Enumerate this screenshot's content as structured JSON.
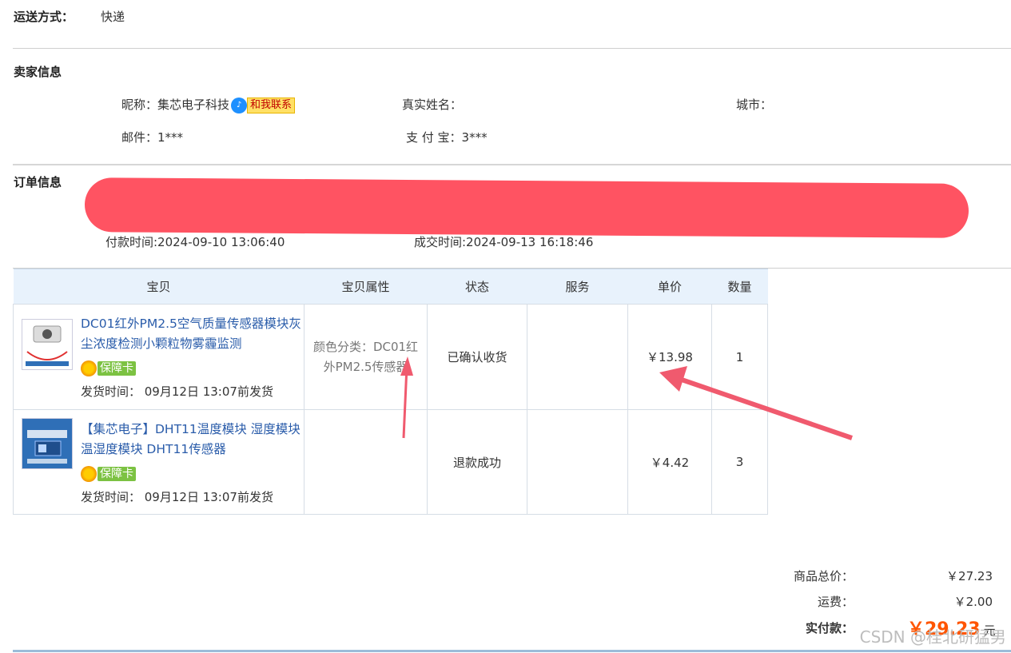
{
  "shipping": {
    "label": "运送方式：",
    "value": "快递"
  },
  "seller": {
    "section_title": "卖家信息",
    "nickname_label": "昵称：",
    "nickname": "集芯电子科技",
    "contact_label": "和我联系",
    "realname_label": "真实姓名：",
    "city_label": "城市：",
    "email_label": "邮件：",
    "email": "1***",
    "alipay_label": "支 付 宝：",
    "alipay": "3***"
  },
  "order": {
    "section_title": "订单信息",
    "paid_time": "付款时间:2024-09-10 13:06:40",
    "deal_time": "成交时间:2024-09-13 16:18:46"
  },
  "table": {
    "headers": [
      "宝贝",
      "宝贝属性",
      "状态",
      "服务",
      "单价",
      "数量"
    ],
    "rows": [
      {
        "title": "DC01红外PM2.5空气质量传感器模块灰尘浓度检测小颗粒物雾霾监测",
        "warranty": "保障卡",
        "ship": "发货时间：  09月12日 13:07前发货",
        "attr": "颜色分类：DC01红外PM2.5传感器",
        "status": "已确认收货",
        "service": "",
        "price": "￥13.98",
        "qty": "1"
      },
      {
        "title": "【集芯电子】DHT11温度模块 湿度模块 温湿度模块 DHT11传感器",
        "warranty": "保障卡",
        "ship": "发货时间：  09月12日 13:07前发货",
        "attr": "",
        "status": "退款成功",
        "service": "",
        "price": "￥4.42",
        "qty": "3"
      }
    ]
  },
  "summary": {
    "goods_label": "商品总价：",
    "goods_value": "￥27.23",
    "freight_label": "运费：",
    "freight_value": "￥2.00",
    "paid_label": "实付款：",
    "paid_value": "￥29.23",
    "paid_unit": "元"
  },
  "watermark": "CSDN @桂北研猛男",
  "colors": {
    "link": "#2a5caa",
    "header_bg": "#e8f2fc",
    "redaction": "#ff5362",
    "annotation_arrow": "#f05a6e",
    "total": "#ff5500"
  }
}
